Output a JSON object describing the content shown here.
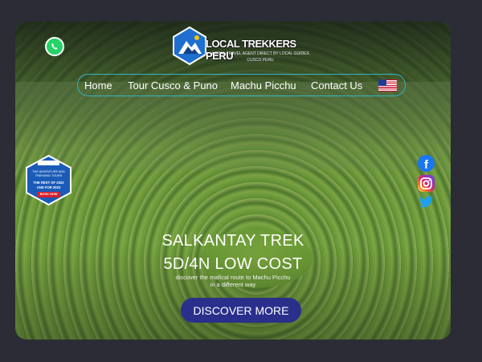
{
  "brand": {
    "name": "LOCAL TREKKERS PERU",
    "tagline": "LOCAL TRAVEL AGENT DIRECT BY LOCAL GUIDES",
    "tagline2": "CUSCO PERU"
  },
  "nav": {
    "items": [
      {
        "label": "Home"
      },
      {
        "label": "Tour Cusco & Puno"
      },
      {
        "label": "Machu Picchu"
      },
      {
        "label": "Contact Us"
      }
    ],
    "language_flag": "us-flag-icon"
  },
  "award": {
    "line1": "THE ADVENTURE AND",
    "line2": "TREKKING TOURS",
    "line3": "THE REST OF 2022",
    "line4": "AND FOR 2023",
    "button": "BOOK NOW"
  },
  "hero": {
    "title_line1": "SALKANTAY TREK",
    "title_line2": "5D/4N LOW COST",
    "subtitle_line1": "discover the mafical route to Machu Picchu",
    "subtitle_line2": "in a different way",
    "cta_label": "DISCOVER MORE"
  },
  "social": [
    "facebook-icon",
    "instagram-icon",
    "twitter-icon"
  ],
  "colors": {
    "page_bg": "#2b2c35",
    "nav_border": "#33b6c8",
    "cta_bg": "#2a2f8c",
    "whatsapp": "#25d366"
  }
}
